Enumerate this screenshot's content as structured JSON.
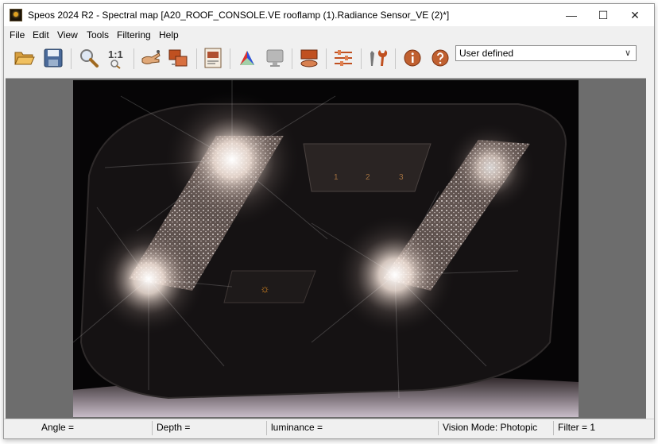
{
  "window": {
    "title": "Speos 2024 R2 - Spectral map [A20_ROOF_CONSOLE.VE rooflamp (1).Radiance Sensor_VE (2)*]",
    "controls": {
      "minimize": "—",
      "maximize": "☐",
      "close": "✕"
    }
  },
  "menu": [
    {
      "label": "File"
    },
    {
      "label": "Edit"
    },
    {
      "label": "View"
    },
    {
      "label": "Tools"
    },
    {
      "label": "Filtering"
    },
    {
      "label": "Help"
    }
  ],
  "toolbar": {
    "zoom_label": "1:1",
    "mode_select": {
      "value": "User defined",
      "options": [
        "User defined"
      ]
    },
    "icons": [
      "open-folder-icon",
      "save-icon",
      "zoom-icon",
      "zoom-one-to-one-icon",
      "hand-pointer-icon",
      "layers-icon",
      "image-properties-icon",
      "color-triangle-icon",
      "monitor-icon",
      "display-icon",
      "adjust-sliders-icon",
      "tools-icon",
      "info-icon",
      "help-icon"
    ]
  },
  "image": {
    "labels": [
      "1",
      "2",
      "3"
    ]
  },
  "status": {
    "angle": "Angle =",
    "depth": "Depth =",
    "luminance": "luminance =",
    "vision_mode": "Vision Mode: Photopic",
    "filter": "Filter = 1"
  }
}
